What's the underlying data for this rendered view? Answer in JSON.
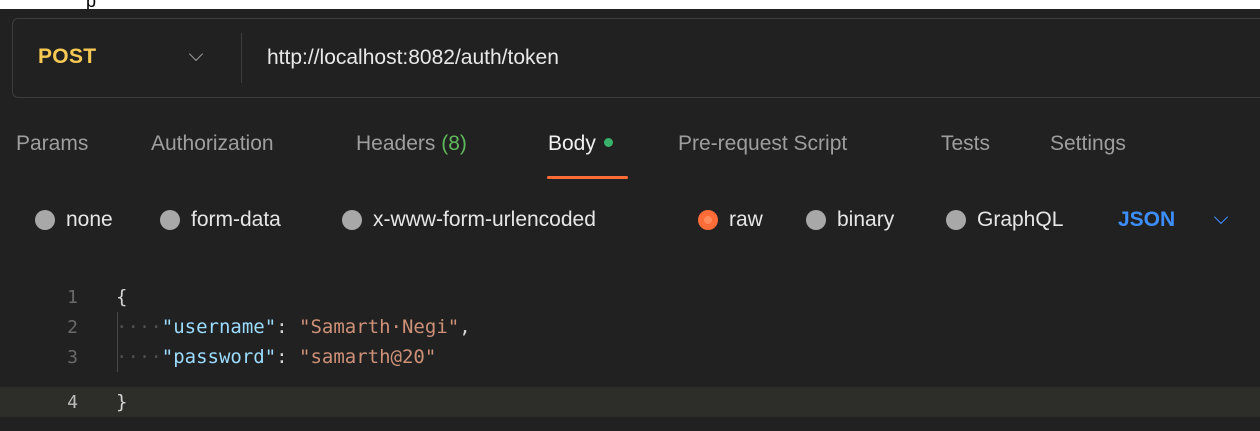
{
  "request": {
    "method": "POST",
    "url": "http://localhost:8082/auth/token"
  },
  "tabs": [
    {
      "label": "Params"
    },
    {
      "label": "Authorization"
    },
    {
      "label": "Headers",
      "count": "(8)"
    },
    {
      "label": "Body",
      "active": true
    },
    {
      "label": "Pre-request Script"
    },
    {
      "label": "Tests"
    },
    {
      "label": "Settings"
    }
  ],
  "body_types": [
    {
      "label": "none",
      "selected": false
    },
    {
      "label": "form-data",
      "selected": false
    },
    {
      "label": "x-www-form-urlencoded",
      "selected": false
    },
    {
      "label": "raw",
      "selected": true
    },
    {
      "label": "binary",
      "selected": false
    },
    {
      "label": "GraphQL",
      "selected": false
    }
  ],
  "format": {
    "label": "JSON"
  },
  "editor": {
    "lines": [
      {
        "number": "1",
        "open_brace": "{"
      },
      {
        "number": "2",
        "indent": "····",
        "key": "\"username\"",
        "colon": ": ",
        "value": "\"Samarth Negi\"",
        "trail": ","
      },
      {
        "number": "3",
        "indent": "····",
        "key": "\"password\"",
        "colon": ": ",
        "value": "\"samarth@20\"",
        "trail": ""
      },
      {
        "number": "4",
        "close_brace": "}"
      }
    ],
    "string_value_spaced": "\"Samarth·Negi\""
  },
  "colors": {
    "accent": "#ff6c37",
    "method": "#f5c953",
    "format": "#3d8eff",
    "json_key": "#9cdcfe",
    "json_string": "#ce9178"
  }
}
